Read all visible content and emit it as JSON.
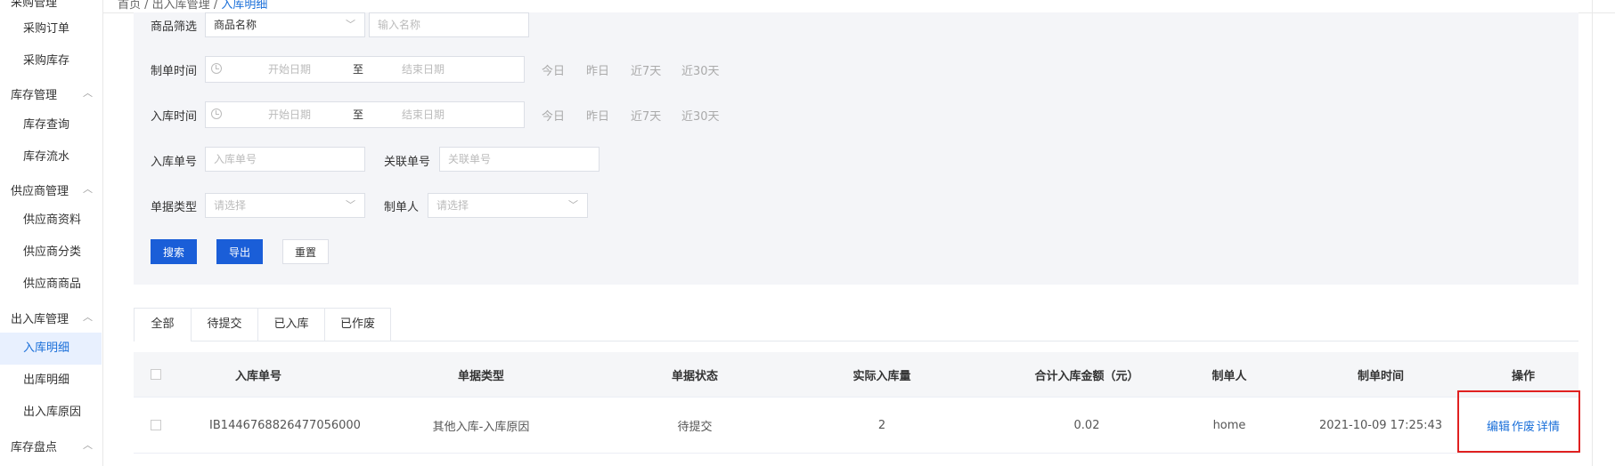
{
  "sidebar": {
    "top_partial": "采购管理",
    "groups": [
      {
        "label": "库存管理",
        "items": [
          "库存查询",
          "库存流水"
        ]
      },
      {
        "label": "供应商管理",
        "items": [
          "供应商资料",
          "供应商分类",
          "供应商商品"
        ]
      },
      {
        "label": "出入库管理",
        "items": [
          "入库明细",
          "出库明细",
          "出入库原因"
        ]
      },
      {
        "label": "库存盘点",
        "items": []
      }
    ],
    "purchase_items": [
      "采购订单",
      "采购库存"
    ],
    "active_item": "入库明细"
  },
  "breadcrumb": {
    "first": "首页",
    "second": "出入库管理",
    "current": "入库明细"
  },
  "filter": {
    "goods_label": "商品筛选",
    "goods_select": "商品名称",
    "goods_input_placeholder": "输入名称",
    "create_time_label": "制单时间",
    "in_time_label": "入库时间",
    "start_placeholder": "开始日期",
    "range_sep": "至",
    "end_placeholder": "结束日期",
    "quick": [
      "今日",
      "昨日",
      "近7天",
      "近30天"
    ],
    "in_no_label": "入库单号",
    "in_no_placeholder": "入库单号",
    "rel_no_label": "关联单号",
    "rel_no_placeholder": "关联单号",
    "doc_type_label": "单据类型",
    "doc_type_placeholder": "请选择",
    "creator_label": "制单人",
    "creator_placeholder": "请选择",
    "search_btn": "搜索",
    "export_btn": "导出",
    "reset_btn": "重置"
  },
  "tabs": [
    "全部",
    "待提交",
    "已入库",
    "已作废"
  ],
  "table": {
    "headers": [
      "入库单号",
      "单据类型",
      "单据状态",
      "实际入库量",
      "合计入库金额（元）",
      "制单人",
      "制单时间",
      "操作"
    ],
    "rows": [
      {
        "no": "IB1446768826477056000",
        "type": "其他入库-入库原因",
        "status": "待提交",
        "qty": "2",
        "amount": "0.02",
        "creator": "home",
        "time": "2021-10-09 17:25:43",
        "ops": [
          "编辑",
          "作废",
          "详情"
        ]
      }
    ]
  },
  "colors": {
    "accent": "#1a5ed8",
    "highlight": "#e02020",
    "panel": "#f4f5f8"
  }
}
